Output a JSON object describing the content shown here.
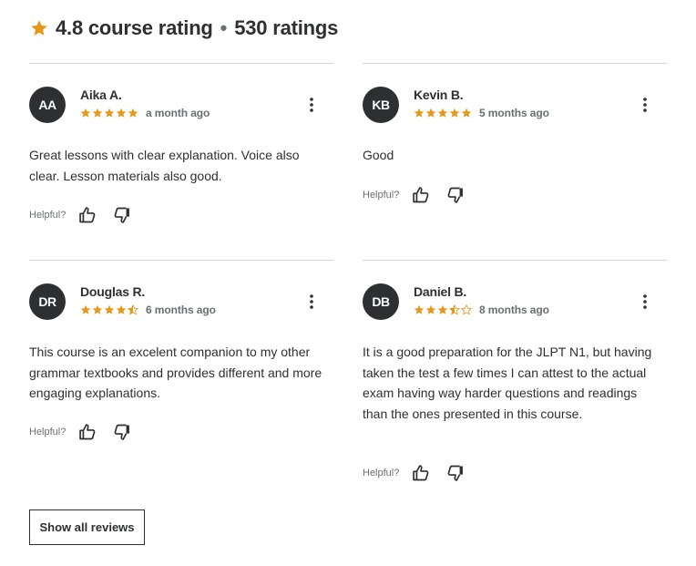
{
  "header": {
    "rating": "4.8 course rating",
    "separator": "•",
    "count": "530 ratings",
    "star_icon": "star-icon",
    "star_color": "#e59819"
  },
  "reviews": [
    {
      "initials": "AA",
      "name": "Aika A.",
      "rating": 5,
      "date": "a month ago",
      "text": "Great lessons with clear explanation. Voice also clear. Lesson materials also good.",
      "helpful_label": "Helpful?"
    },
    {
      "initials": "KB",
      "name": "Kevin B.",
      "rating": 5,
      "date": "5 months ago",
      "text": "Good",
      "helpful_label": "Helpful?"
    },
    {
      "initials": "DR",
      "name": "Douglas R.",
      "rating": 4.5,
      "date": "6 months ago",
      "text": "This course is an excelent companion to my other grammar textbooks and provides different and more engaging explanations.",
      "helpful_label": "Helpful?"
    },
    {
      "initials": "DB",
      "name": "Daniel B.",
      "rating": 3.5,
      "date": "8 months ago",
      "text": "It is a good preparation for the JLPT N1, but having taken the test a few times I can attest to the actual exam having way harder questions and readings than the ones presented in this course.",
      "helpful_label": "Helpful?"
    }
  ],
  "icons": {
    "more": "more-options-icon",
    "thumbs_up": "thumbs-up-icon",
    "thumbs_down": "thumbs-down-icon"
  },
  "show_all_label": "Show all reviews"
}
